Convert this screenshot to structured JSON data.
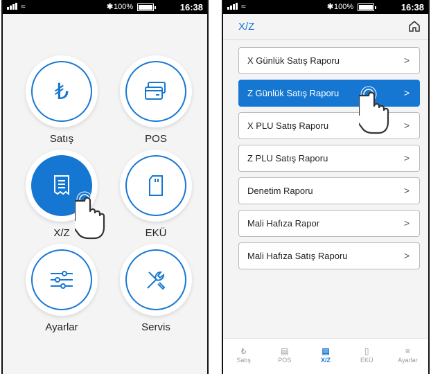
{
  "status_bar": {
    "battery": "100%",
    "time": "16:38"
  },
  "home": {
    "tiles": [
      {
        "label": "Satış",
        "icon": "lira-icon"
      },
      {
        "label": "POS",
        "icon": "card-icon"
      },
      {
        "label": "X/Z",
        "icon": "receipt-icon"
      },
      {
        "label": "EKÜ",
        "icon": "memory-card-icon"
      },
      {
        "label": "Ayarlar",
        "icon": "sliders-icon"
      },
      {
        "label": "Servis",
        "icon": "tools-icon"
      }
    ]
  },
  "xz": {
    "title": "X/Z",
    "items": [
      {
        "label": "X Günlük Satış Raporu"
      },
      {
        "label": "Z Günlük Satış Raporu"
      },
      {
        "label": "X PLU Satış Raporu"
      },
      {
        "label": "Z PLU Satış Raporu"
      },
      {
        "label": "Denetim Raporu"
      },
      {
        "label": "Mali Hafıza Rapor"
      },
      {
        "label": "Mali Hafıza Satış Raporu"
      }
    ],
    "chevron": ">"
  },
  "bottom_nav": [
    {
      "label": "Satış"
    },
    {
      "label": "POS"
    },
    {
      "label": "X/Z"
    },
    {
      "label": "EKÜ"
    },
    {
      "label": "Ayarlar"
    }
  ],
  "colors": {
    "accent": "#1677d2",
    "background": "#f4f4f4"
  }
}
